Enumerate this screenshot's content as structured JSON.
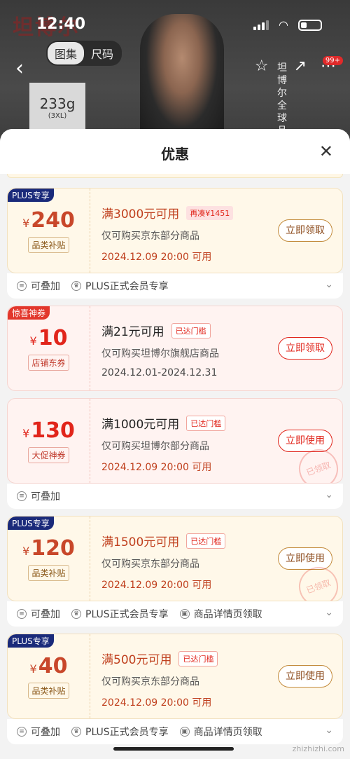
{
  "status": {
    "time": "12:40"
  },
  "bg": {
    "brand_logo": "坦博尔",
    "tabs": [
      "图集",
      "尺码"
    ],
    "weight": "233g",
    "size": "(3XL)",
    "brand_vertical": "坦博尔全球品",
    "badge": "99+"
  },
  "sheet": {
    "title": "优惠"
  },
  "coupons": [
    {
      "corner": "PLUS专享",
      "currency": "¥",
      "amount": "240",
      "tag": "品类补贴",
      "condition": "满3000元可用",
      "chip": "再凑¥1451",
      "scope": "仅可购买京东部分商品",
      "date": "2024.12.09 20:00 可用",
      "button": "立即领取",
      "features": [
        "可叠加",
        "PLUS正式会员专享"
      ]
    },
    {
      "corner": "惊喜神券",
      "currency": "¥",
      "amount": "10",
      "tag": "店铺东券",
      "condition": "满21元可用",
      "chip": "已达门槛",
      "scope": "仅可购买坦博尔旗舰店商品",
      "date": "2024.12.01-2024.12.31",
      "button": "立即领取",
      "features": []
    },
    {
      "corner": "",
      "currency": "¥",
      "amount": "130",
      "tag": "大促神券",
      "condition": "满1000元可用",
      "chip": "已达门槛",
      "scope": "仅可购买坦博尔部分商品",
      "date": "2024.12.09 20:00 可用",
      "button": "立即使用",
      "stamp": "已领取",
      "features": [
        "可叠加"
      ]
    },
    {
      "corner": "PLUS专享",
      "currency": "¥",
      "amount": "120",
      "tag": "品类补贴",
      "condition": "满1500元可用",
      "chip": "已达门槛",
      "scope": "仅可购买京东部分商品",
      "date": "2024.12.09 20:00 可用",
      "button": "立即使用",
      "stamp": "已领取",
      "features": [
        "可叠加",
        "PLUS正式会员专享",
        "商品详情页领取"
      ]
    },
    {
      "corner": "PLUS专享",
      "currency": "¥",
      "amount": "40",
      "tag": "品类补贴",
      "condition": "满500元可用",
      "chip": "已达门槛",
      "scope": "仅可购买京东部分商品",
      "date": "2024.12.09 20:00 可用",
      "button": "立即使用",
      "features": [
        "可叠加",
        "PLUS正式会员专享",
        "商品详情页领取"
      ]
    }
  ],
  "watermark": "zhizhizhi.com"
}
